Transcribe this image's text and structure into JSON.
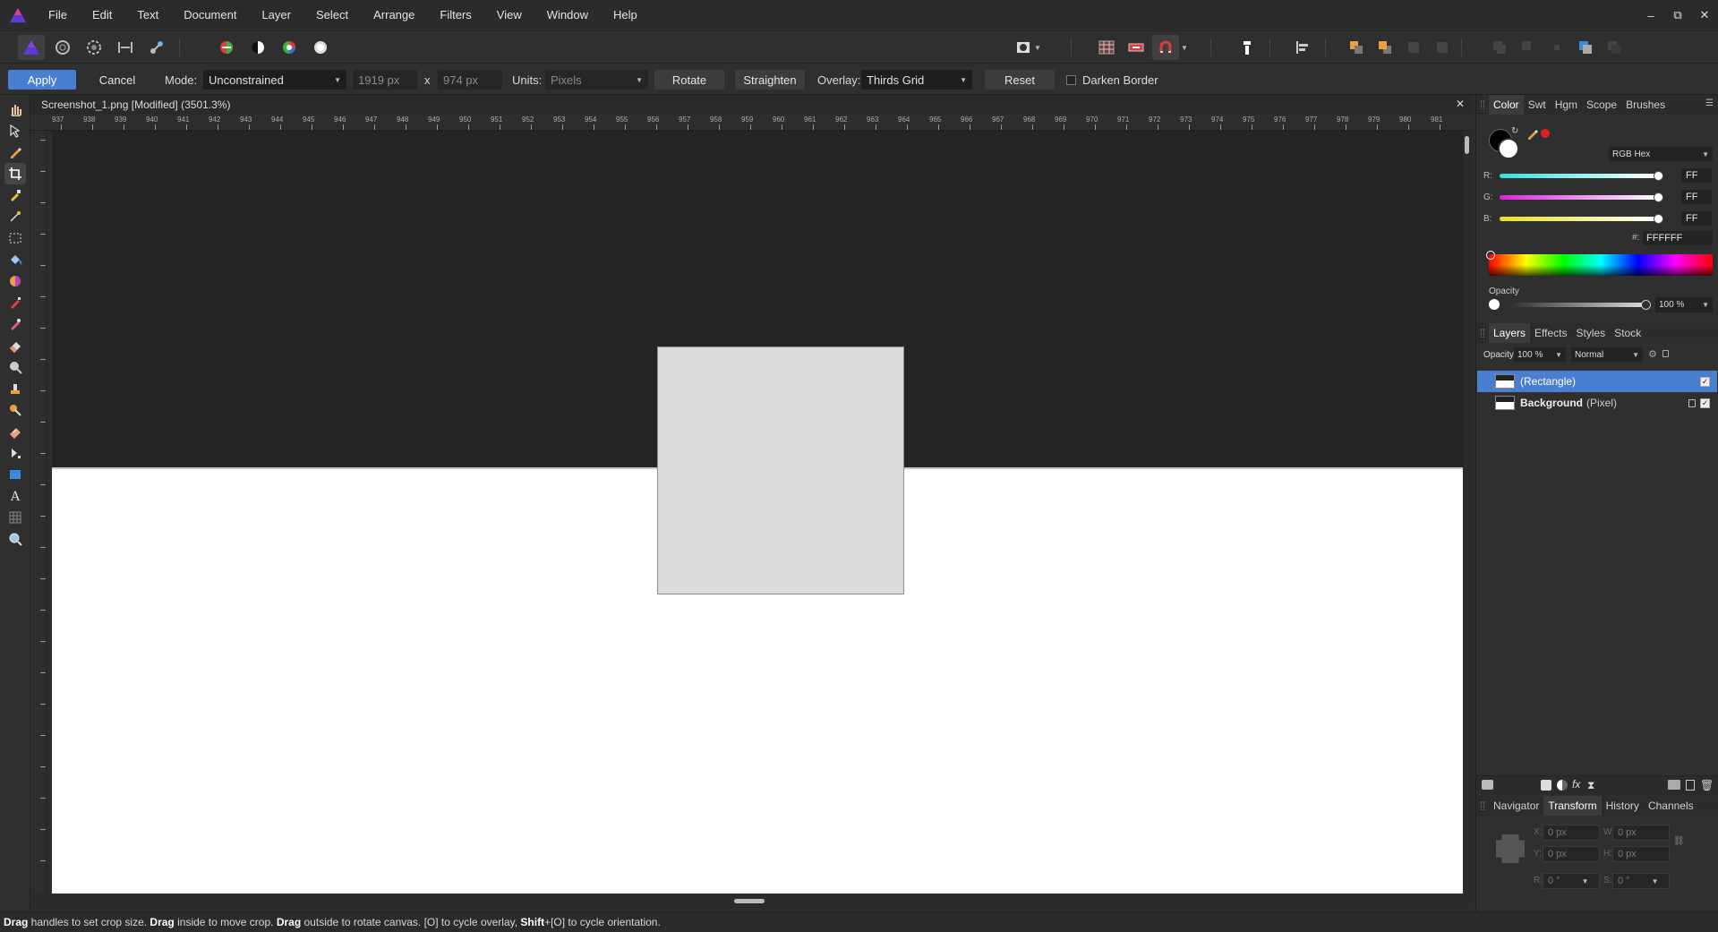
{
  "menu": {
    "items": [
      "File",
      "Edit",
      "Text",
      "Document",
      "Layer",
      "Select",
      "Arrange",
      "Filters",
      "View",
      "Window",
      "Help"
    ]
  },
  "window": {
    "minimize": "–",
    "restore": "⧉",
    "close": "✕"
  },
  "context": {
    "apply": "Apply",
    "cancel": "Cancel",
    "mode_label": "Mode:",
    "mode_value": "Unconstrained",
    "width": "1919 px",
    "x_sep": "x",
    "height": "974 px",
    "units_label": "Units:",
    "units_value": "Pixels",
    "rotate": "Rotate",
    "straighten": "Straighten",
    "overlay_label": "Overlay:",
    "overlay_value": "Thirds Grid",
    "reset": "Reset",
    "darken_border": "Darken Border"
  },
  "document": {
    "title": "Screenshot_1.png [Modified] (3501.3%)",
    "close": "✕",
    "ruler_h": [
      "937",
      "938",
      "939",
      "940",
      "941",
      "942",
      "943",
      "944",
      "945",
      "946",
      "947",
      "948",
      "949",
      "950",
      "951",
      "952",
      "953",
      "954",
      "955",
      "956",
      "957",
      "958",
      "959",
      "960",
      "961",
      "962",
      "963",
      "964",
      "965",
      "966",
      "967",
      "968",
      "969",
      "970",
      "971",
      "972",
      "973",
      "974",
      "975",
      "976",
      "977",
      "978",
      "979",
      "980",
      "981"
    ]
  },
  "status": {
    "b1": "Drag",
    "t1": " handles to set crop size. ",
    "b2": "Drag",
    "t2": " inside to move crop. ",
    "b3": "Drag",
    "t3": " outside to rotate canvas. [O] to cycle overlay, ",
    "b4": "Shift",
    "t4": "+[O] to cycle orientation."
  },
  "color_panel": {
    "tabs": [
      "Color",
      "Swt",
      "Hgm",
      "Scope",
      "Brushes"
    ],
    "model": "RGB Hex",
    "r_label": "R:",
    "r_value": "FF",
    "g_label": "G:",
    "g_value": "FF",
    "b_label": "B:",
    "b_value": "FF",
    "hex_label": "#:",
    "hex_value": "FFFFFF",
    "opacity_label": "Opacity",
    "opacity_value": "100 %",
    "colors": {
      "primary": "#000000",
      "secondary": "#ffffff",
      "accent": "#e02020"
    }
  },
  "layers_panel": {
    "tabs": [
      "Layers",
      "Effects",
      "Styles",
      "Stock"
    ],
    "opacity_label": "Opacity:",
    "opacity_value": "100 %",
    "blend": "Normal",
    "layers": [
      {
        "name": "(Rectangle)",
        "selected": true
      },
      {
        "name": "Background",
        "suffix": "(Pixel)",
        "selected": false
      }
    ]
  },
  "bottom_panel": {
    "tabs": [
      "Navigator",
      "Transform",
      "History",
      "Channels"
    ],
    "x_label": "X:",
    "x_value": "0 px",
    "y_label": "Y:",
    "y_value": "0 px",
    "w_label": "W:",
    "w_value": "0 px",
    "h_label": "H:",
    "h_value": "0 px",
    "r_label": "R:",
    "r_value": "0 °",
    "s_label": "S:",
    "s_value": "0 °"
  }
}
